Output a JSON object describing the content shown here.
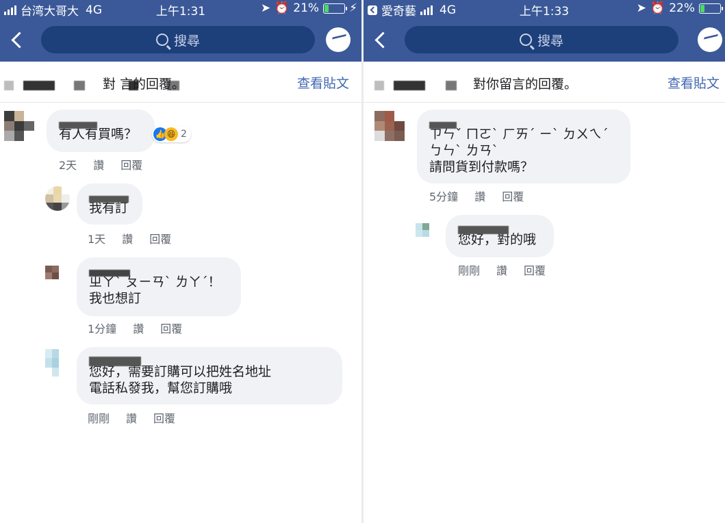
{
  "left": {
    "status": {
      "carrier": "台湾大哥大",
      "network": "4G",
      "time": "上午1:31",
      "battery": "21%",
      "battery_level": 0.21
    },
    "search_placeholder": "搜尋",
    "subheader_title": "對                  言的回覆。",
    "view_post": "查看貼文",
    "comments": [
      {
        "text": "有人有買嗎？",
        "time": "2天",
        "reactions_count": "2"
      },
      {
        "text": "我有訂",
        "time": "1天"
      },
      {
        "text_line1": "ㄓㄚˋ ㄆㄧㄢˋ ㄌㄚˊ！",
        "text_line2": "我也想訂",
        "time": "1分鐘"
      },
      {
        "text_line1": "您好，需要訂購可以把姓名地址",
        "text_line2": "電話私發我，幫您訂購哦",
        "time": "剛剛"
      }
    ]
  },
  "right": {
    "status": {
      "carrier": "愛奇藝",
      "network": "4G",
      "time": "上午1:33",
      "battery": "22%",
      "battery_level": 0.22
    },
    "search_placeholder": "搜尋",
    "subheader_title": "對你留言的回覆。",
    "view_post": "查看貼文",
    "comments": [
      {
        "text_line1": "ㄗㄣˇ ㄇㄛˋ ㄏㄞˊ ㄧˋ ㄉㄨㄟˊ",
        "text_line2": "ㄅㄣˋ ㄌㄢˋ",
        "text_line3": "請問貨到付款嗎？",
        "time": "5分鐘"
      },
      {
        "text": "您好，對的哦",
        "time": "剛剛"
      }
    ]
  },
  "labels": {
    "like": "讚",
    "reply": "回覆"
  },
  "colors": {
    "nav": "#3b5998",
    "link": "#4267b2",
    "bubble": "#f0f2f5"
  }
}
